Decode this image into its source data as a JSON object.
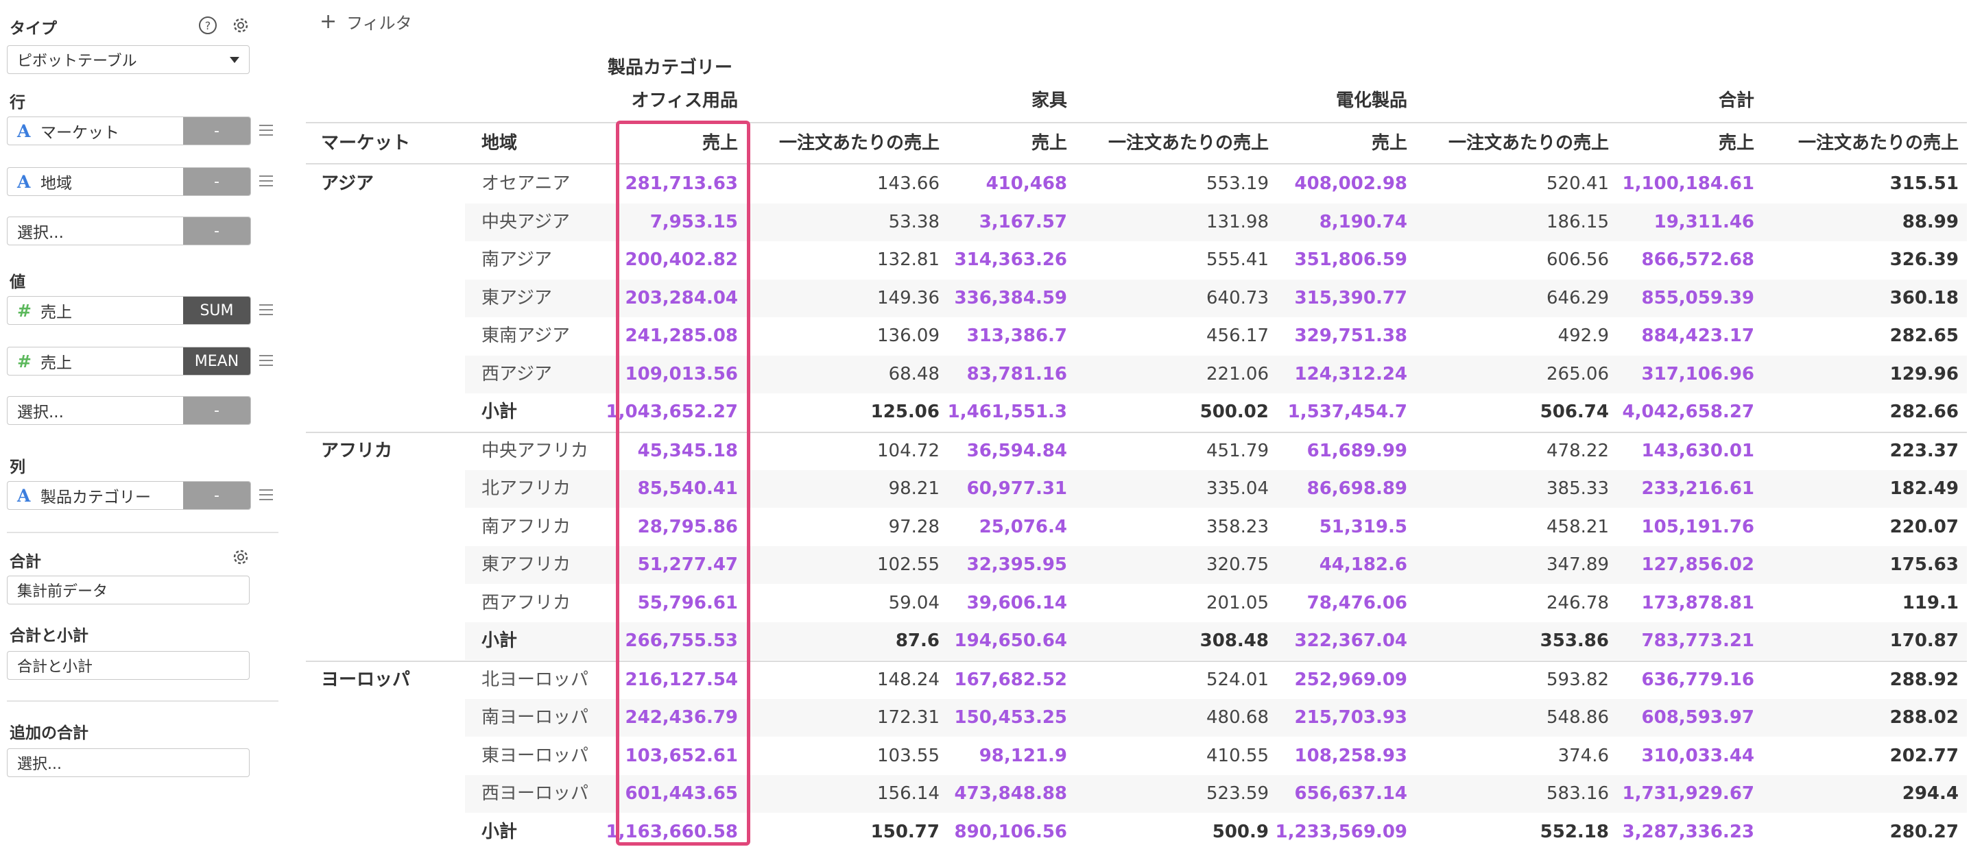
{
  "sidebar": {
    "type_label": "タイプ",
    "type_value": "ピボットテーブル",
    "rows_label": "行",
    "rows": [
      {
        "icon": "A",
        "name": "マーケット",
        "tag": "-"
      },
      {
        "icon": "A",
        "name": "地域",
        "tag": "-"
      },
      {
        "icon": "",
        "name": "選択...",
        "tag": "-"
      }
    ],
    "values_label": "値",
    "values": [
      {
        "icon": "#",
        "name": "売上",
        "tag": "SUM"
      },
      {
        "icon": "#",
        "name": "売上",
        "tag": "MEAN"
      },
      {
        "icon": "",
        "name": "選択...",
        "tag": "-"
      }
    ],
    "columns_label": "列",
    "columns": [
      {
        "icon": "A",
        "name": "製品カテゴリー",
        "tag": "-"
      }
    ],
    "total_label": "合計",
    "total_value": "集計前データ",
    "total_sub_label": "合計と小計",
    "total_sub_value": "合計と小計",
    "extra_total_label": "追加の合計",
    "extra_total_value": "選択..."
  },
  "filter": {
    "label": "フィルタ"
  },
  "table": {
    "col_group_title": "製品カテゴリー",
    "categories": [
      "オフィス用品",
      "家具",
      "電化製品",
      "合計"
    ],
    "row_headers": [
      "マーケット",
      "地域"
    ],
    "measures": [
      "売上",
      "一注文あたりの売上"
    ],
    "groups": [
      {
        "market": "アジア",
        "rows": [
          {
            "region": "オセアニア",
            "v": [
              "281,713.63",
              "143.66",
              "410,468",
              "553.19",
              "408,002.98",
              "520.41",
              "1,100,184.61",
              "315.51"
            ]
          },
          {
            "region": "中央アジア",
            "v": [
              "7,953.15",
              "53.38",
              "3,167.57",
              "131.98",
              "8,190.74",
              "186.15",
              "19,311.46",
              "88.99"
            ]
          },
          {
            "region": "南アジア",
            "v": [
              "200,402.82",
              "132.81",
              "314,363.26",
              "555.41",
              "351,806.59",
              "606.56",
              "866,572.68",
              "326.39"
            ]
          },
          {
            "region": "東アジア",
            "v": [
              "203,284.04",
              "149.36",
              "336,384.59",
              "640.73",
              "315,390.77",
              "646.29",
              "855,059.39",
              "360.18"
            ]
          },
          {
            "region": "東南アジア",
            "v": [
              "241,285.08",
              "136.09",
              "313,386.7",
              "456.17",
              "329,751.38",
              "492.9",
              "884,423.17",
              "282.65"
            ]
          },
          {
            "region": "西アジア",
            "v": [
              "109,013.56",
              "68.48",
              "83,781.16",
              "221.06",
              "124,312.24",
              "265.06",
              "317,106.96",
              "129.96"
            ]
          },
          {
            "region": "小計",
            "v": [
              "1,043,652.27",
              "125.06",
              "1,461,551.3",
              "500.02",
              "1,537,454.7",
              "506.74",
              "4,042,658.27",
              "282.66"
            ]
          }
        ]
      },
      {
        "market": "アフリカ",
        "rows": [
          {
            "region": "中央アフリカ",
            "v": [
              "45,345.18",
              "104.72",
              "36,594.84",
              "451.79",
              "61,689.99",
              "478.22",
              "143,630.01",
              "223.37"
            ]
          },
          {
            "region": "北アフリカ",
            "v": [
              "85,540.41",
              "98.21",
              "60,977.31",
              "335.04",
              "86,698.89",
              "385.33",
              "233,216.61",
              "182.49"
            ]
          },
          {
            "region": "南アフリカ",
            "v": [
              "28,795.86",
              "97.28",
              "25,076.4",
              "358.23",
              "51,319.5",
              "458.21",
              "105,191.76",
              "220.07"
            ]
          },
          {
            "region": "東アフリカ",
            "v": [
              "51,277.47",
              "102.55",
              "32,395.95",
              "320.75",
              "44,182.6",
              "347.89",
              "127,856.02",
              "175.63"
            ]
          },
          {
            "region": "西アフリカ",
            "v": [
              "55,796.61",
              "59.04",
              "39,606.14",
              "201.05",
              "78,476.06",
              "246.78",
              "173,878.81",
              "119.1"
            ]
          },
          {
            "region": "小計",
            "v": [
              "266,755.53",
              "87.6",
              "194,650.64",
              "308.48",
              "322,367.04",
              "353.86",
              "783,773.21",
              "170.87"
            ]
          }
        ]
      },
      {
        "market": "ヨーロッパ",
        "rows": [
          {
            "region": "北ヨーロッパ",
            "v": [
              "216,127.54",
              "148.24",
              "167,682.52",
              "524.01",
              "252,969.09",
              "593.82",
              "636,779.16",
              "288.92"
            ]
          },
          {
            "region": "南ヨーロッパ",
            "v": [
              "242,436.79",
              "172.31",
              "150,453.25",
              "480.68",
              "215,703.93",
              "548.86",
              "608,593.97",
              "288.02"
            ]
          },
          {
            "region": "東ヨーロッパ",
            "v": [
              "103,652.61",
              "103.55",
              "98,121.9",
              "410.55",
              "108,258.93",
              "374.6",
              "310,033.44",
              "202.77"
            ]
          },
          {
            "region": "西ヨーロッパ",
            "v": [
              "601,443.65",
              "156.14",
              "473,848.88",
              "523.59",
              "656,637.14",
              "583.16",
              "1,731,929.67",
              "294.4"
            ]
          },
          {
            "region": "小計",
            "v": [
              "1,163,660.58",
              "150.77",
              "890,106.56",
              "500.9",
              "1,233,569.09",
              "552.18",
              "3,287,336.23",
              "280.27"
            ]
          }
        ]
      }
    ]
  }
}
